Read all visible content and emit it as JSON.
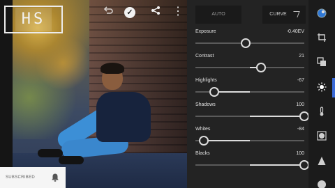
{
  "watermark": {
    "text": "HS"
  },
  "photo": {
    "subject": ""
  },
  "subscribe": {
    "label": "SUBSCRIBED",
    "bell": "bell-icon"
  },
  "toolbar": {
    "undo": "undo-icon",
    "check": "✓",
    "share": "share-icon",
    "more": "⋮"
  },
  "panel": {
    "auto_label": "AUTO",
    "curve_label": "CURVE",
    "adjustments": [
      {
        "name": "Exposure",
        "value": "-0.40EV",
        "level": 0.46
      },
      {
        "name": "Contrast",
        "value": "21",
        "level": 0.6
      },
      {
        "name": "Highlights",
        "value": "-67",
        "level": 0.17
      },
      {
        "name": "Shadows",
        "value": "100",
        "level": 1.0
      },
      {
        "name": "Whites",
        "value": "-84",
        "level": 0.08
      },
      {
        "name": "Blacks",
        "value": "100",
        "level": 1.0
      }
    ]
  },
  "tools": [
    {
      "icon": "color-wheel-icon"
    },
    {
      "icon": "crop-rotate-icon"
    },
    {
      "icon": "layers-icon"
    },
    {
      "icon": "light-icon",
      "active": true
    },
    {
      "icon": "temperature-icon"
    },
    {
      "icon": "vignette-icon"
    },
    {
      "icon": "detail-icon"
    },
    {
      "icon": "optics-icon"
    }
  ],
  "colors": {
    "active": "#3a6ad8",
    "panel": "#232323",
    "track": "#5a5a5a"
  }
}
